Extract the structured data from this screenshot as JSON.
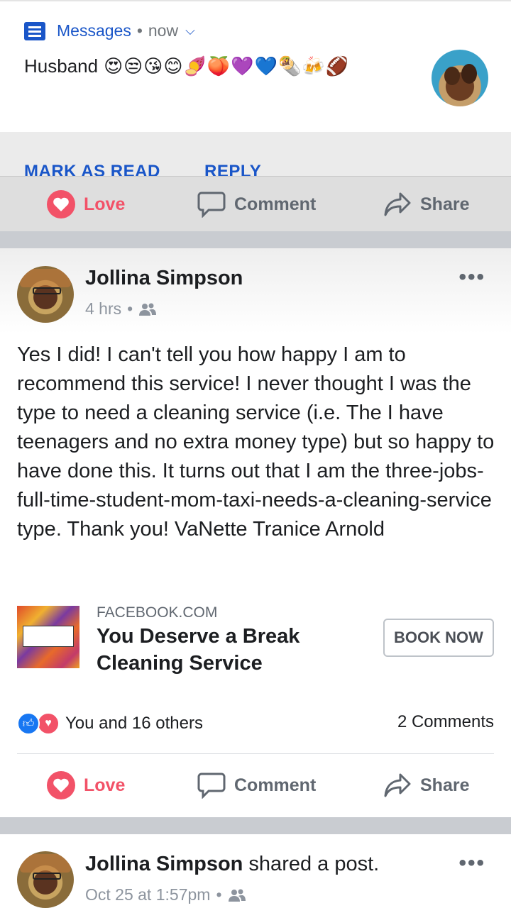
{
  "notification": {
    "app_name": "Messages",
    "separator": "•",
    "time": "now",
    "sender": "Husband",
    "emojis": "😍😒😘😊🍠🍑💜💙🌯🍻🏈",
    "actions": {
      "mark_read": "MARK AS READ",
      "reply": "REPLY"
    }
  },
  "prev_post_actions": {
    "love": "Love",
    "comment": "Comment",
    "share": "Share"
  },
  "post": {
    "author": "Jollina Simpson",
    "time": "4 hrs",
    "separator": "•",
    "text": "Yes I did! I can't tell you how happy I am to recommend this service!  I never thought I was the type to need a cleaning service (i.e. The I have teenagers and no extra money type) but so happy to have done this. It turns out that I am the three-jobs-full-time-student-mom-taxi-needs-a-cleaning-service type. Thank you! VaNette Tranice Arnold",
    "link": {
      "domain": "FACEBOOK.COM",
      "title": "You Deserve a Break Cleaning Service",
      "button": "BOOK NOW"
    },
    "reactions_text": "You and 16 others",
    "comments_count": "2 Comments",
    "actions": {
      "love": "Love",
      "comment": "Comment",
      "share": "Share"
    }
  },
  "post2": {
    "author": "Jollina Simpson",
    "action": " shared a post.",
    "time": "Oct 25 at 1:57pm",
    "separator": "•"
  },
  "colors": {
    "facebook_blue": "#1877f2",
    "love_red": "#f25268",
    "android_blue": "#1a56c8"
  }
}
